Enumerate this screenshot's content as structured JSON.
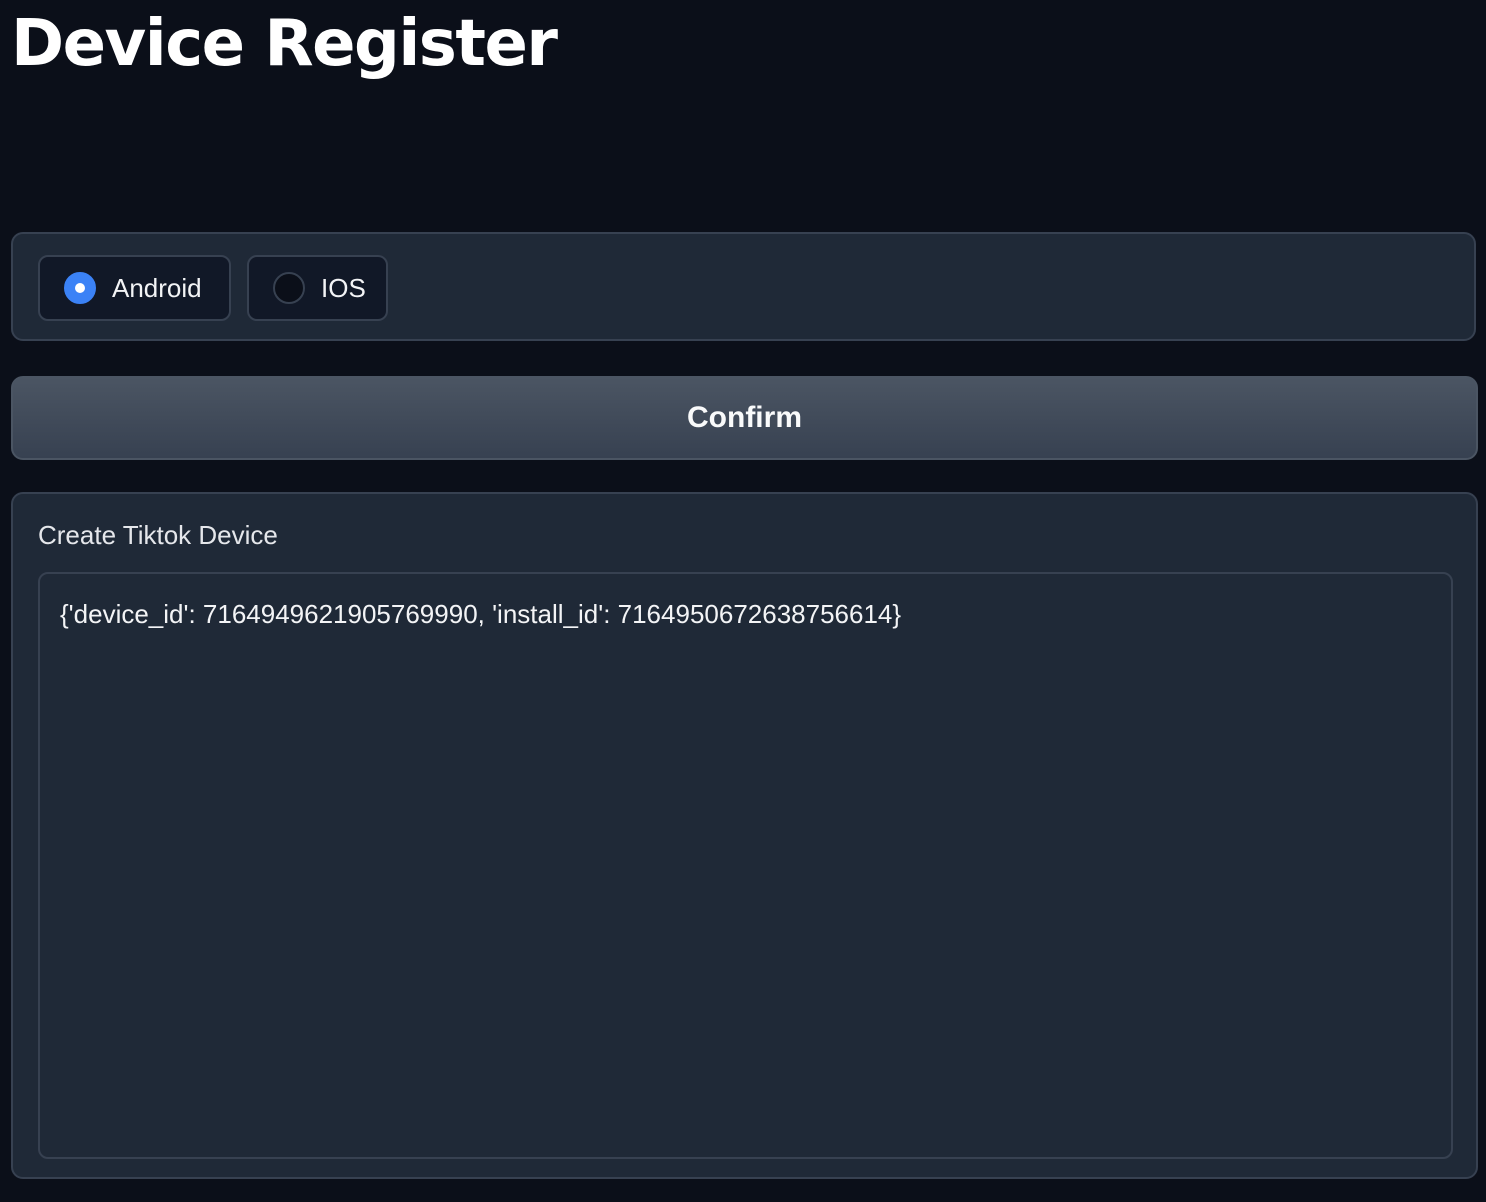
{
  "page": {
    "title": "Device Register"
  },
  "platform": {
    "options": [
      {
        "label": "Android",
        "checked": true
      },
      {
        "label": "IOS",
        "checked": false
      }
    ],
    "selected": "Android"
  },
  "actions": {
    "confirm_label": "Confirm"
  },
  "output": {
    "label": "Create Tiktok Device",
    "value": "{'device_id': 7164949621905769990, 'install_id': 7164950672638756614}"
  },
  "colors": {
    "background": "#0b0f19",
    "panel": "#1f2937",
    "border": "#374151",
    "accent": "#3b82f6"
  }
}
